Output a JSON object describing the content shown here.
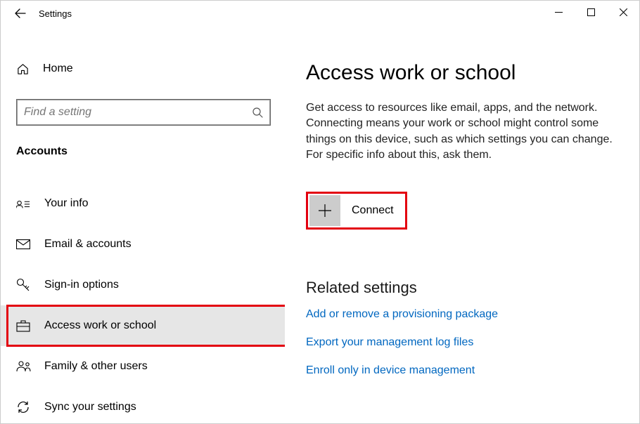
{
  "window": {
    "title": "Settings"
  },
  "sidebar": {
    "home": "Home",
    "search_placeholder": "Find a setting",
    "category": "Accounts",
    "items": [
      {
        "label": "Your info"
      },
      {
        "label": "Email & accounts"
      },
      {
        "label": "Sign-in options"
      },
      {
        "label": "Access work or school"
      },
      {
        "label": "Family & other users"
      },
      {
        "label": "Sync your settings"
      }
    ]
  },
  "main": {
    "title": "Access work or school",
    "description": "Get access to resources like email, apps, and the network. Connecting means your work or school might control some things on this device, such as which settings you can change. For specific info about this, ask them.",
    "connect_label": "Connect",
    "related_heading": "Related settings",
    "links": [
      "Add or remove a provisioning package",
      "Export your management log files",
      "Enroll only in device management"
    ]
  }
}
